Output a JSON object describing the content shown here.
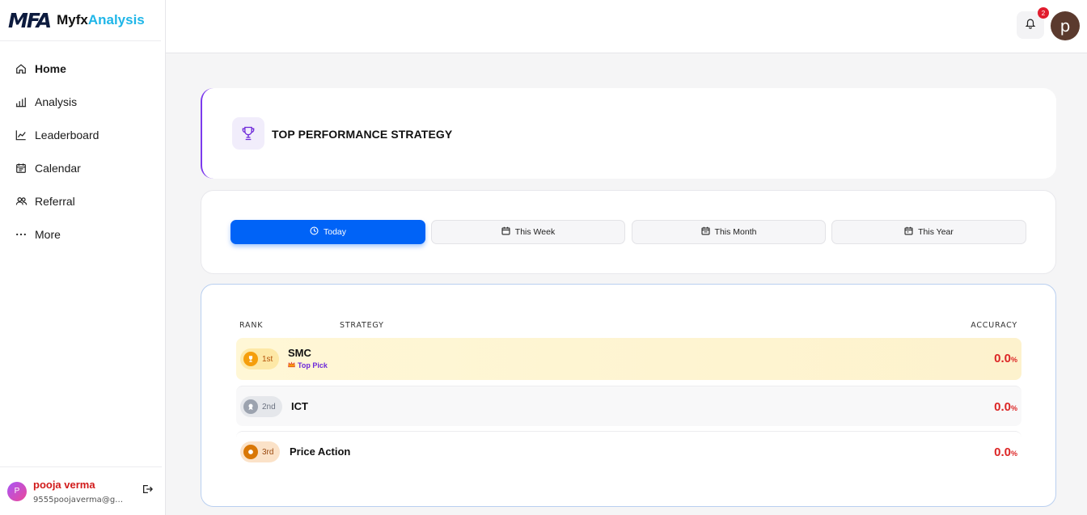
{
  "brand": {
    "logo": "MFA",
    "name_part1": "Myfx",
    "name_part2": "Analysis"
  },
  "sidebar": {
    "items": [
      {
        "label": "Home",
        "icon": "home-icon"
      },
      {
        "label": "Analysis",
        "icon": "bar-chart-icon"
      },
      {
        "label": "Leaderboard",
        "icon": "line-chart-icon"
      },
      {
        "label": "Calendar",
        "icon": "calendar-icon"
      },
      {
        "label": "Referral",
        "icon": "users-icon"
      },
      {
        "label": "More",
        "icon": "more-icon"
      }
    ],
    "user": {
      "initial": "P",
      "name": "pooja verma",
      "email": "9555poojaverma@gm..."
    }
  },
  "header": {
    "notification_count": "2",
    "avatar_letter": "p"
  },
  "title_card": {
    "title": "TOP PERFORMANCE STRATEGY"
  },
  "tabs": [
    {
      "label": "Today",
      "icon": "clock-icon",
      "active": true
    },
    {
      "label": "This Week",
      "icon": "calendar-icon"
    },
    {
      "label": "This Month",
      "icon": "calendar-icon"
    },
    {
      "label": "This Year",
      "icon": "calendar-icon"
    }
  ],
  "table": {
    "headers": {
      "rank": "RANK",
      "strategy": "STRATEGY",
      "accuracy": "ACCURACY"
    },
    "rows": [
      {
        "rank": "1st",
        "strategy": "SMC",
        "badge": "Top Pick",
        "accuracy": "0.0",
        "unit": "%"
      },
      {
        "rank": "2nd",
        "strategy": "ICT",
        "accuracy": "0.0",
        "unit": "%"
      },
      {
        "rank": "3rd",
        "strategy": "Price Action",
        "accuracy": "0.0",
        "unit": "%"
      }
    ]
  },
  "colors": {
    "accent": "#0063f7",
    "danger": "#dc2626",
    "purple": "#7c3aed"
  }
}
